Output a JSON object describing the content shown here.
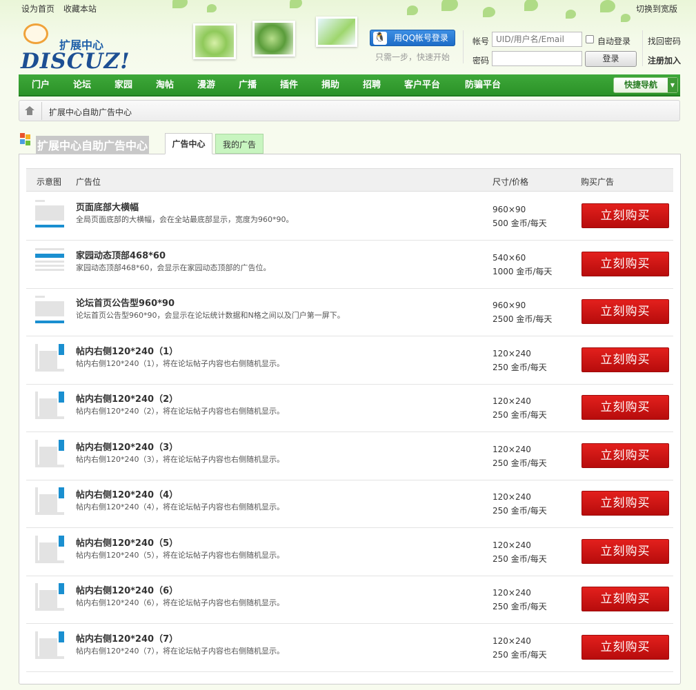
{
  "topbar": {
    "set_home": "设为首页",
    "bookmark": "收藏本站",
    "switch_wide": "切换到宽版"
  },
  "logo": {
    "title": "扩展中心",
    "brand": "DISCUZ!"
  },
  "qq": {
    "button_label": "用QQ帐号登录",
    "subtext": "只需一步，快速开始"
  },
  "login": {
    "account_label": "帐号",
    "account_placeholder": "UID/用户名/Email",
    "auto_login": "自动登录",
    "password_label": "密码",
    "login_button": "登录",
    "find_password": "找回密码",
    "register": "注册加入"
  },
  "nav": {
    "items": [
      "门户",
      "论坛",
      "家园",
      "淘帖",
      "漫游",
      "广播",
      "插件",
      "捐助",
      "招聘",
      "客户平台",
      "防骗平台"
    ],
    "quick_nav": "快捷导航"
  },
  "breadcrumb": {
    "current": "扩展中心自助广告中心"
  },
  "page": {
    "title": "扩展中心自助广告中心",
    "tabs": [
      "广告中心",
      "我的广告"
    ]
  },
  "table": {
    "headers": [
      "示意图",
      "广告位",
      "尺寸/价格",
      "购买广告"
    ],
    "buy_label": "立刻购买",
    "rows": [
      {
        "name": "页面底部大横幅",
        "desc": "全局页面底部的大横幅，会在全站最底部显示，宽度为960*90。",
        "size": "960×90",
        "price": "500 金币/每天",
        "thumb": "bottom"
      },
      {
        "name": "家园动态顶部468*60",
        "desc": "家园动态顶部468*60，会显示在家园动态顶部的广告位。",
        "size": "540×60",
        "price": "1000 金币/每天",
        "thumb": "top"
      },
      {
        "name": "论坛首页公告型960*90",
        "desc": "论坛首页公告型960*90，会显示在论坛统计数据和N格之间以及门户第一屏下。",
        "size": "960×90",
        "price": "2500 金币/每天",
        "thumb": "bottom"
      },
      {
        "name": "帖内右侧120*240（1）",
        "desc": "帖内右侧120*240（1），将在论坛帖子内容也右侧随机显示。",
        "size": "120×240",
        "price": "250 金币/每天",
        "thumb": "side"
      },
      {
        "name": "帖内右侧120*240（2）",
        "desc": "帖内右侧120*240（2），将在论坛帖子内容也右侧随机显示。",
        "size": "120×240",
        "price": "250 金币/每天",
        "thumb": "side"
      },
      {
        "name": "帖内右侧120*240（3）",
        "desc": "帖内右侧120*240（3），将在论坛帖子内容也右侧随机显示。",
        "size": "120×240",
        "price": "250 金币/每天",
        "thumb": "side"
      },
      {
        "name": "帖内右侧120*240（4）",
        "desc": "帖内右侧120*240（4），将在论坛帖子内容也右侧随机显示。",
        "size": "120×240",
        "price": "250 金币/每天",
        "thumb": "side"
      },
      {
        "name": "帖内右侧120*240（5）",
        "desc": "帖内右侧120*240（5），将在论坛帖子内容也右侧随机显示。",
        "size": "120×240",
        "price": "250 金币/每天",
        "thumb": "side"
      },
      {
        "name": "帖内右侧120*240（6）",
        "desc": "帖内右侧120*240（6），将在论坛帖子内容也右侧随机显示。",
        "size": "120×240",
        "price": "250 金币/每天",
        "thumb": "side"
      },
      {
        "name": "帖内右侧120*240（7）",
        "desc": "帖内右侧120*240（7），将在论坛帖子内容也右侧随机显示。",
        "size": "120×240",
        "price": "250 金币/每天",
        "thumb": "side"
      }
    ]
  },
  "colors": {
    "nav_green": "#2b9227",
    "buy_red": "#c8110f",
    "brand_blue": "#1d4f93"
  }
}
